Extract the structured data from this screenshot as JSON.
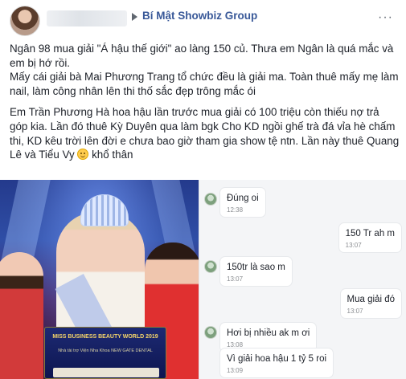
{
  "post": {
    "group_name": "Bí Mật Showbiz Group",
    "more_label": "···",
    "paragraphs": [
      "Ngân 98 mua giải \"Á hậu thế giới\" ao làng 150 củ. Thưa em Ngân là quá mắc và em bị hớ rồi.",
      "Mấy cái giải bà Mai Phương Trang tổ chức đều là giải ma. Toàn thuê mấy mẹ làm nail, làm công nhân lên thi thố sắc đẹp trông mắc ói",
      "Em Trần Phương Hà hoa hậu lần trước mua giải có 100 triệu còn thiếu nợ trả góp kia. Lần đó thuê Kỳ Duyên qua làm bgk Cho KD ngồi ghế trà đá vỉa hè chấm thi, KD kêu trời lên đời e chưa bao giờ tham gia show tệ ntn. Lần này thuê Quang Lê và Tiểu Vy",
      "khổ thân"
    ]
  },
  "photo": {
    "board_line1": "MISS BUSINESS BEAUTY WORLD 2019",
    "board_line2": "Nhà tài trợ Viện Nha Khoa NEW GATE DENTAL"
  },
  "chat": {
    "messages": [
      {
        "side": "in",
        "text": "Đúng oi",
        "time": "12:38"
      },
      {
        "side": "out",
        "text": "150 Tr ah m",
        "time": "13:07"
      },
      {
        "side": "in",
        "text": "150tr là sao m",
        "time": "13:07"
      },
      {
        "side": "out",
        "text": "Mua giải đó",
        "time": "13:07"
      },
      {
        "side": "in",
        "text": "Hơi bị nhiều ak m ơi",
        "time": "13:08"
      },
      {
        "side": "in",
        "text": "Vì giải hoa hậu 1 tỷ 5 roi",
        "time": "13:09"
      }
    ]
  }
}
